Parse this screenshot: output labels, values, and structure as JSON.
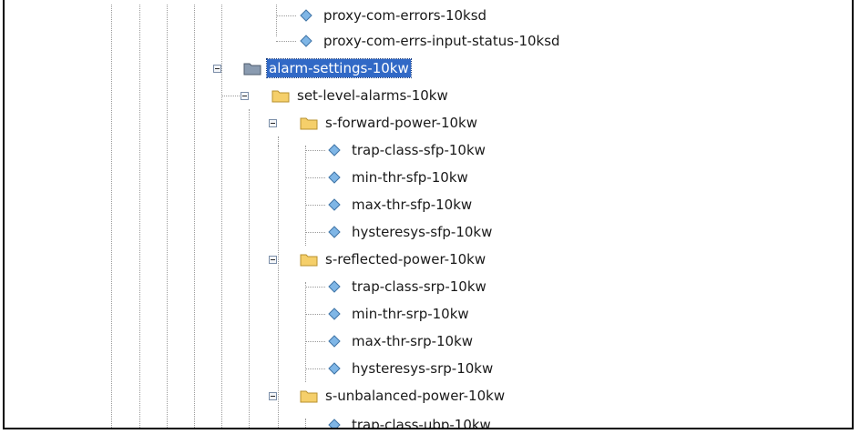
{
  "tree": {
    "top": [
      {
        "label": "proxy-com-errors-10ksd"
      },
      {
        "label": "proxy-com-errs-input-status-10ksd"
      }
    ],
    "alarm_settings": {
      "label": "alarm-settings-10kw",
      "selected": true
    },
    "set_level_alarms": {
      "label": "set-level-alarms-10kw"
    },
    "forward_power": {
      "label": "s-forward-power-10kw",
      "leaves": [
        "trap-class-sfp-10kw",
        "min-thr-sfp-10kw",
        "max-thr-sfp-10kw",
        "hysteresys-sfp-10kw"
      ]
    },
    "reflected_power": {
      "label": "s-reflected-power-10kw",
      "leaves": [
        "trap-class-srp-10kw",
        "min-thr-srp-10kw",
        "max-thr-srp-10kw",
        "hysteresys-srp-10kw"
      ]
    },
    "unbalanced_power": {
      "label": "s-unbalanced-power-10kw",
      "leaves": [
        "trap-class-ubp-10kw"
      ]
    }
  },
  "colors": {
    "selection": "#3169c6",
    "folder": "#f5cf6a",
    "folder_selected": "#8a9bb0",
    "leaf": "#7fb6e6"
  },
  "icons": {
    "folder": "folder-icon",
    "leaf": "diamond-node-icon",
    "expander": "collapse-minus-icon"
  }
}
